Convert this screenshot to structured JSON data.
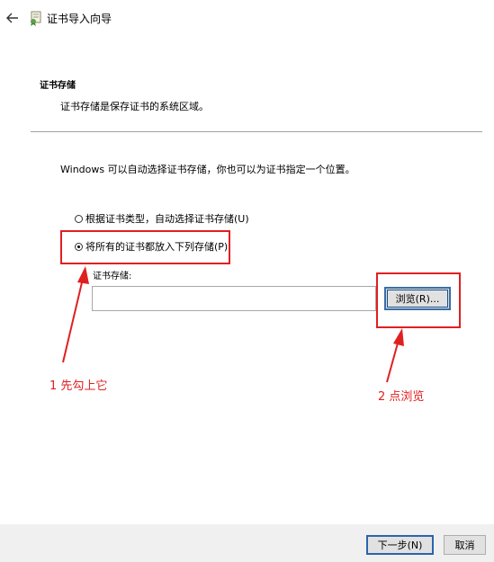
{
  "window": {
    "title": "证书导入向导",
    "back_icon": "back-arrow-icon",
    "app_icon": "certificate-icon"
  },
  "section": {
    "heading": "证书存储",
    "description": "证书存储是保存证书的系统区域。"
  },
  "intro_text": "Windows 可以自动选择证书存储，你也可以为证书指定一个位置。",
  "options": [
    {
      "label": "根据证书类型，自动选择证书存储(U)",
      "selected": false
    },
    {
      "label": "将所有的证书都放入下列存储(P)",
      "selected": true
    }
  ],
  "store": {
    "label": "证书存储:",
    "value": "",
    "browse_label": "浏览(R)..."
  },
  "annotations": {
    "step1": "1 先勾上它",
    "step2": "2 点浏览",
    "color": "#e02020"
  },
  "footer": {
    "next_label": "下一步(N)",
    "cancel_label": "取消"
  }
}
